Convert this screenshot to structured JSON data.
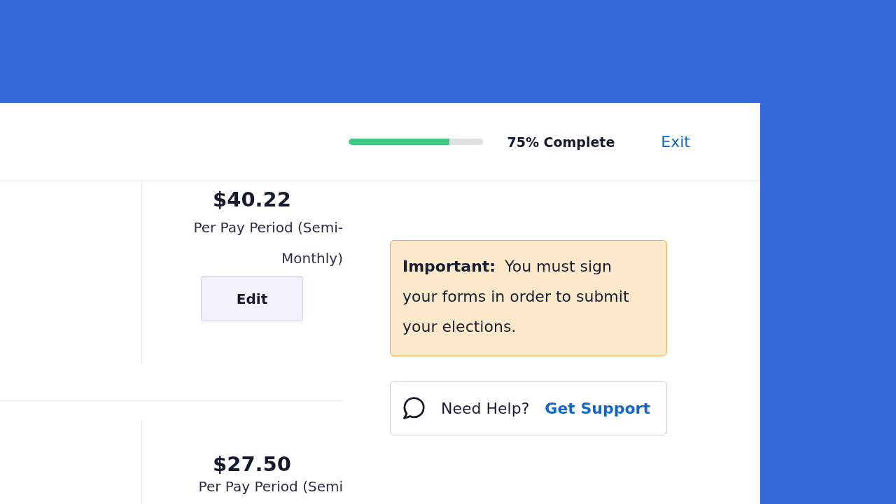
{
  "header": {
    "progress": {
      "level": 0.75,
      "label": "75% Complete"
    },
    "exit_link": "Exit"
  },
  "elections": [
    {
      "amount": "$40.22",
      "period": "Per Pay Period (Semi-Monthly)",
      "action": "Edit"
    },
    {
      "amount": "$27.50",
      "period": "Per Pay Period (Semi"
    }
  ],
  "notice": {
    "text": "**Important:** You must sign your forms in order to submit your elections."
  },
  "help": {
    "label": "Need Help?",
    "link": "Get Support"
  }
}
